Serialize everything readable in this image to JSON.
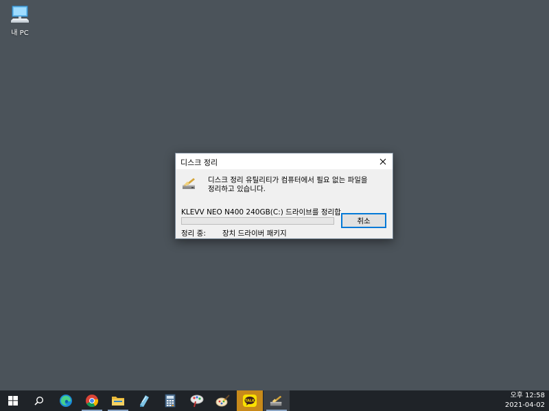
{
  "desktop": {
    "icons": [
      {
        "label": "내 PC",
        "icon": "computer-icon"
      }
    ]
  },
  "dialog": {
    "title": "디스크 정리",
    "message_line1": "디스크 정리 유틸리티가 컴퓨터에서 필요 없는 파일을",
    "message_line2": "정리하고 있습니다.",
    "drive_text": "KLEVV NEO N400 240GB(C:) 드라이브를 정리합",
    "progress": 0,
    "cancel_label": "취소",
    "status_label": "정리 중:",
    "status_value": "장치 드라이버 패키지",
    "accent_color": "#0078d7"
  },
  "taskbar": {
    "apps": [
      {
        "name": "start",
        "icon": "windows-logo-icon"
      },
      {
        "name": "search",
        "icon": "search-icon"
      },
      {
        "name": "edge",
        "icon": "edge-icon"
      },
      {
        "name": "chrome",
        "icon": "chrome-icon",
        "running": true
      },
      {
        "name": "file-explorer",
        "icon": "folder-icon",
        "running": true
      },
      {
        "name": "notes",
        "icon": "notepad-icon"
      },
      {
        "name": "calculator",
        "icon": "calculator-icon"
      },
      {
        "name": "paint",
        "icon": "paint-icon"
      },
      {
        "name": "settings-tool",
        "icon": "brush-icon"
      },
      {
        "name": "kakaotalk",
        "icon": "kakaotalk-icon",
        "badge": "TALK"
      },
      {
        "name": "disk-cleanup",
        "icon": "disk-cleanup-icon",
        "active": true
      }
    ],
    "clock": {
      "time": "오후 12:58",
      "date": "2021-04-02"
    }
  }
}
